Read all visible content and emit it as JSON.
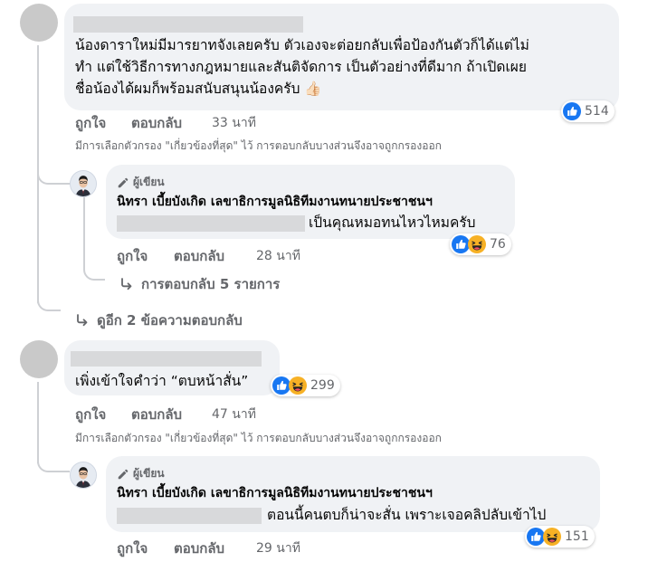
{
  "colors": {
    "like_blue": "#1877f2",
    "haha_yellow": "#f7b125",
    "text": "#050505",
    "muted": "#65676b",
    "bubble": "#f0f2f5"
  },
  "comments": [
    {
      "body": [
        "น้องดาราใหม่มีมารยาทจังเลยครับ ตัวเองจะต่อยกลับเพื่อป้องกันตัวก็ได้แต่ไม่",
        "ทำ แต่ใช้วิธีการทางกฎหมายและสันติจัดการ เป็นตัวอย่างที่ดีมาก ถ้าเปิดเผย",
        "ชื่อน้องได้ผมก็พร้อมสนับสนุนน้องครับ 👍🏻"
      ],
      "reaction_count": "514",
      "reactions": [
        "like-icon"
      ],
      "like_label": "ถูกใจ",
      "reply_label": "ตอบกลับ",
      "time": "33 นาที",
      "filter_note": "มีการเลือกตัวกรอง \"เกี่ยวข้องที่สุด\" ไว้ การตอบกลับบางส่วนจึงอาจถูกกรองออก",
      "reply": {
        "author_label": "ผู้เขียน",
        "author_name": "นิทรา เบี้ยบังเกิด เลขาธิการมูลนิธิทีมงานทนายประชาชนฯ",
        "text": "เป็นคุณหมอทนไหวไหมครับ",
        "reaction_count": "76",
        "reactions": [
          "like-icon",
          "haha-icon"
        ],
        "like_label": "ถูกใจ",
        "reply_label": "ตอบกลับ",
        "time": "28 นาที",
        "more_replies": "การตอบกลับ 5 รายการ"
      },
      "view_more": "ดูอีก 2 ข้อความตอบกลับ"
    },
    {
      "body": [
        "เพิ่งเข้าใจคำว่า “ตบหน้าสั่น”"
      ],
      "reaction_count": "299",
      "reactions": [
        "like-icon",
        "haha-icon"
      ],
      "like_label": "ถูกใจ",
      "reply_label": "ตอบกลับ",
      "time": "47 นาที",
      "filter_note": "มีการเลือกตัวกรอง \"เกี่ยวข้องที่สุด\" ไว้ การตอบกลับบางส่วนจึงอาจถูกกรองออก",
      "reply": {
        "author_label": "ผู้เขียน",
        "author_name": "นิทรา เบี้ยบังเกิด เลขาธิการมูลนิธิทีมงานทนายประชาชนฯ",
        "text": "ตอนนี้คนตบก็น่าจะสั่น เพราะเจอคลิปลับเข้าไป",
        "reaction_count": "151",
        "reactions": [
          "like-icon",
          "haha-icon"
        ],
        "like_label": "ถูกใจ",
        "reply_label": "ตอบกลับ",
        "time": "29 นาที"
      }
    }
  ]
}
